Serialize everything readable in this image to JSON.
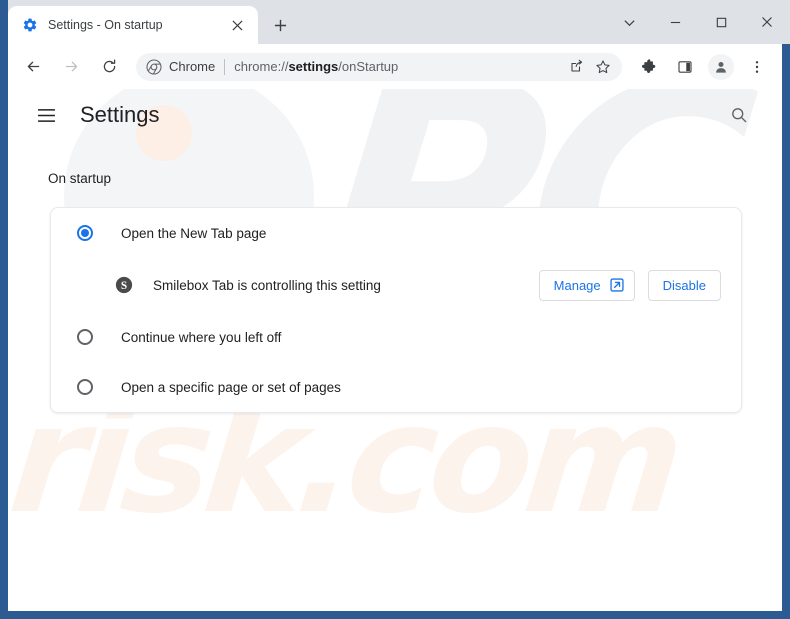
{
  "window": {
    "frame_color": "#2c5b93",
    "controls": [
      {
        "name": "tab-search",
        "glyph": "chevron-down"
      },
      {
        "name": "minimize",
        "glyph": "minus"
      },
      {
        "name": "maximize",
        "glyph": "square"
      },
      {
        "name": "close",
        "glyph": "x"
      }
    ]
  },
  "tabstrip": {
    "tab": {
      "title": "Settings - On startup",
      "favicon": "gear-icon",
      "close_label": "×"
    },
    "new_tab_label": "+"
  },
  "toolbar": {
    "back_label": "←",
    "forward_label": "→",
    "reload_label": "⟳",
    "omnibox": {
      "scheme_label": "Chrome",
      "url_prefix": "chrome://",
      "url_bold": "settings",
      "url_suffix": "/onStartup",
      "share_icon": "share-icon",
      "bookmark_icon": "star-icon"
    },
    "extensions_icon": "puzzle-icon",
    "side_panel_icon": "side-panel-icon",
    "profile_icon": "avatar-icon",
    "menu_icon": "three-dot-menu-icon"
  },
  "settings": {
    "menu_label": "Menu",
    "title": "Settings",
    "search_label": "Search settings",
    "section_title": "On startup",
    "options": [
      {
        "label": "Open the New Tab page",
        "selected": true
      },
      {
        "label": "Continue where you left off",
        "selected": false
      },
      {
        "label": "Open a specific page or set of pages",
        "selected": false
      }
    ],
    "extension_notice": {
      "icon_letter": "S",
      "text": "Smilebox Tab is controlling this setting",
      "manage_label": "Manage",
      "disable_label": "Disable"
    }
  },
  "watermark": {
    "primary": "PC",
    "secondary": "risk.com"
  },
  "colors": {
    "accent": "#1a73e8",
    "frame": "#2c5b93",
    "tabstrip": "#dee1e6",
    "omnibox_bg": "#f1f3f4",
    "text_primary": "#202124",
    "text_secondary": "#5f6368",
    "card_border": "#e8eaed"
  }
}
